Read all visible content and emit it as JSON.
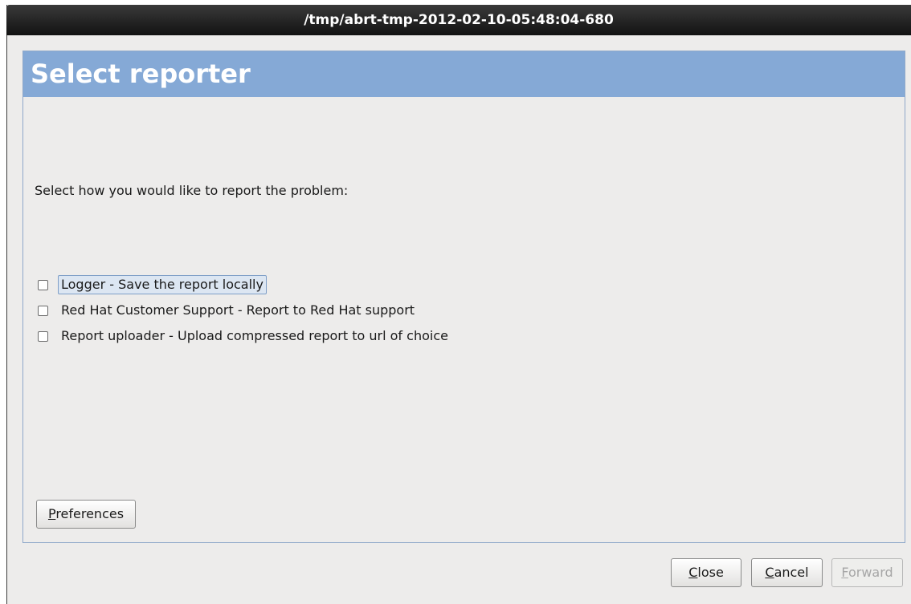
{
  "window": {
    "title": "/tmp/abrt-tmp-2012-02-10-05:48:04-680"
  },
  "header": {
    "title": "Select reporter"
  },
  "main": {
    "instruction": "Select how you would like to report the problem:",
    "options": [
      {
        "label": "Logger - Save the report locally",
        "checked": false,
        "focused": true
      },
      {
        "label": "Red Hat Customer Support - Report to Red Hat support",
        "checked": false,
        "focused": false
      },
      {
        "label": "Report uploader - Upload compressed report to url of choice",
        "checked": false,
        "focused": false
      }
    ],
    "preferences_button": {
      "mnemonic": "P",
      "rest": "references"
    }
  },
  "footer": {
    "close_button": {
      "mnemonic": "C",
      "rest": "lose"
    },
    "cancel_button": {
      "mnemonic": "C",
      "rest": "ancel"
    },
    "forward_button": {
      "mnemonic": "F",
      "rest": "orward",
      "enabled": false
    }
  },
  "colors": {
    "header_bg": "#85a9d6",
    "window_bg": "#edeceb",
    "titlebar_bg": "#1e1e1e"
  }
}
